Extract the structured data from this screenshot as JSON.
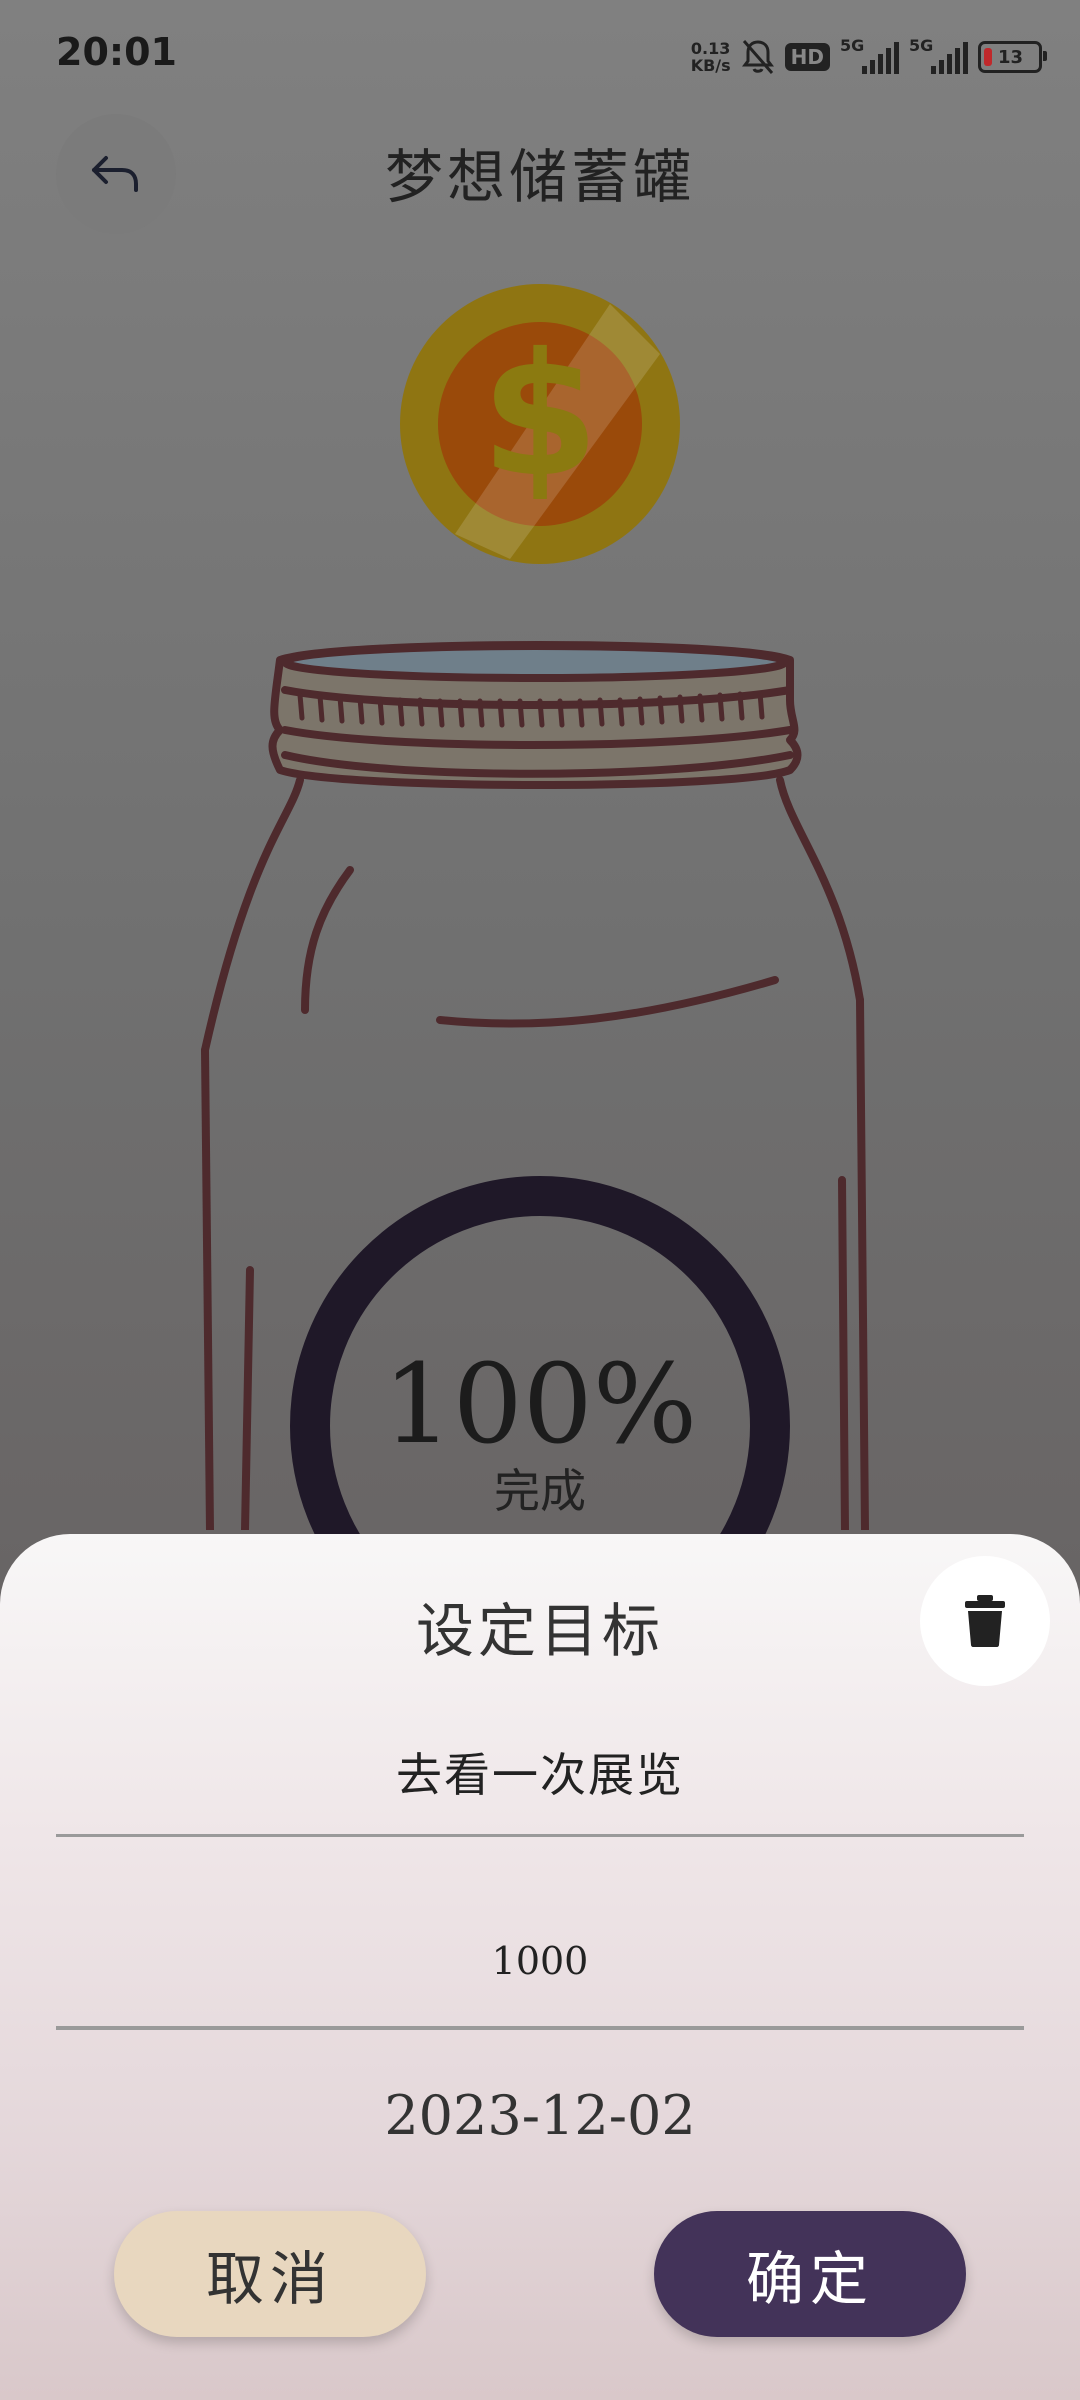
{
  "status_bar": {
    "time": "20:01",
    "net_speed_value": "0.13",
    "net_speed_unit": "KB/s",
    "hd_label": "HD",
    "signal1_label": "5G",
    "signal2_label": "5G",
    "battery_level": "13"
  },
  "header": {
    "title": "梦想储蓄罐",
    "back_icon": "back-arrow-icon"
  },
  "progress": {
    "value": "100%",
    "label": "完成",
    "fraction": 1.0
  },
  "sheet": {
    "title": "设定目标",
    "delete_icon": "trash-icon",
    "goal_name": "去看一次展览",
    "amount": "1000",
    "date": "2023-12-02",
    "cancel_label": "取消",
    "confirm_label": "确定"
  },
  "colors": {
    "confirm_button": "#433359",
    "cancel_button": "#e8d7bf",
    "ring": "#1f1828",
    "coin_outer": "#d9a514",
    "coin_inner": "#c8530a"
  }
}
